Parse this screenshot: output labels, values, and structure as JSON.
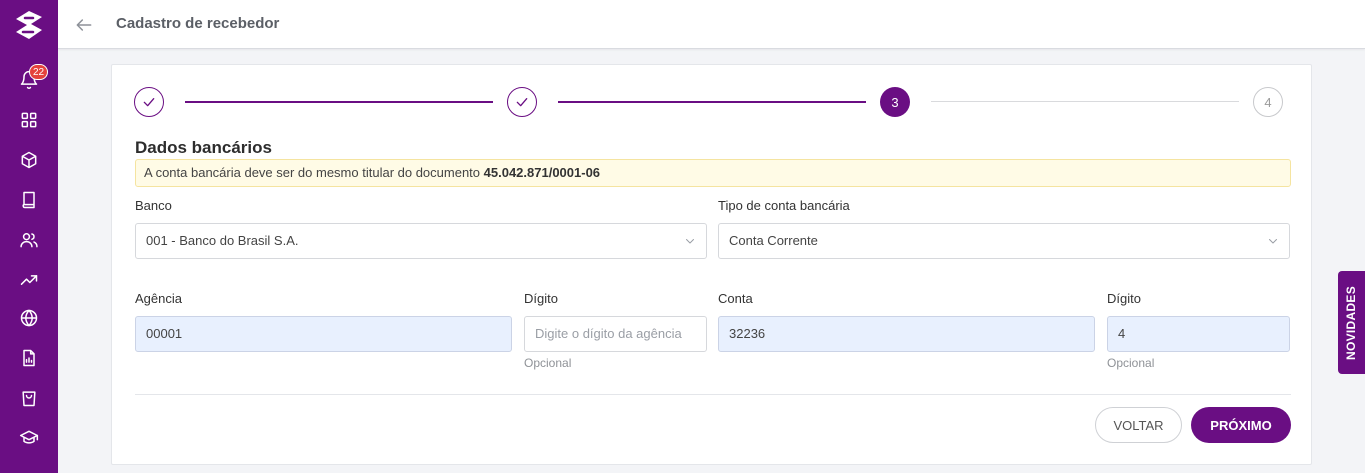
{
  "sidebar": {
    "notification_count": "22",
    "items": [
      "bell-icon",
      "grid-icon",
      "box-icon",
      "book-icon",
      "users-icon",
      "trending-icon",
      "globe-icon",
      "report-icon",
      "bag-icon",
      "graduation-icon"
    ]
  },
  "header": {
    "title": "Cadastro de recebedor"
  },
  "stepper": {
    "steps": [
      {
        "label": "",
        "state": "done"
      },
      {
        "label": "",
        "state": "done"
      },
      {
        "label": "3",
        "state": "current"
      },
      {
        "label": "4",
        "state": "pending"
      }
    ]
  },
  "form": {
    "section_title": "Dados bancários",
    "alert_text": "A conta bancária deve ser do mesmo titular do documento ",
    "alert_document": "45.042.871/0001-06",
    "bank_label": "Banco",
    "bank_value": "001 - Banco do Brasil S.A.",
    "account_type_label": "Tipo de conta bancária",
    "account_type_value": "Conta Corrente",
    "agency_label": "Agência",
    "agency_value": "00001",
    "agency_digit_label": "Dígito",
    "agency_digit_placeholder": "Digite o dígito da agência",
    "agency_digit_hint": "Opcional",
    "account_label": "Conta",
    "account_value": "32236",
    "account_digit_label": "Dígito",
    "account_digit_value": "4",
    "account_digit_hint": "Opcional"
  },
  "actions": {
    "back_label": "VOLTAR",
    "next_label": "PRÓXIMO"
  },
  "side_tab": {
    "label": "NOVIDADES"
  },
  "colors": {
    "brand": "#6a0e83",
    "alert_bg": "#fffbe6",
    "filled_bg": "#e8f0fe"
  }
}
